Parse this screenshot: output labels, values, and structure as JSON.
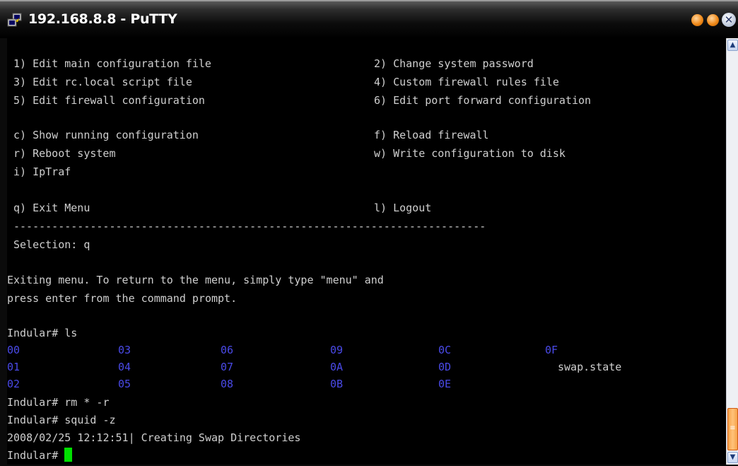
{
  "window": {
    "title": "192.168.8.8 - PuTTY"
  },
  "terminal": {
    "menu": [
      {
        "left": "1) Edit main configuration file",
        "right": "2) Change system password"
      },
      {
        "left": "3) Edit rc.local script file",
        "right": "4) Custom firewall rules file"
      },
      {
        "left": "5) Edit firewall configuration",
        "right": "6) Edit port forward configuration"
      },
      {
        "left": "c) Show running configuration",
        "right": "f) Reload firewall"
      },
      {
        "left": "r) Reboot system",
        "right": "w) Write configuration to disk"
      },
      {
        "left": "i) IpTraf",
        "right": ""
      },
      {
        "left": "q) Exit Menu",
        "right": "l) Logout"
      }
    ],
    "separator": "--------------------------------------------------------------------------",
    "selection": "Selection: q",
    "exit_line1": "Exiting menu. To return to the menu, simply type \"menu\" and",
    "exit_line2": "press enter from the command prompt.",
    "cmd_ls": "Indular# ls",
    "ls_rows": [
      [
        "00",
        "03",
        "06",
        "09",
        "0C",
        "0F"
      ],
      [
        "01",
        "04",
        "07",
        "0A",
        "0D",
        "swap.state"
      ],
      [
        "02",
        "05",
        "08",
        "0B",
        "0E",
        ""
      ]
    ],
    "cmd_rm": "Indular# rm * -r",
    "cmd_squid": "Indular# squid -z",
    "squid_output": "2008/02/25 12:12:51| Creating Swap Directories",
    "prompt": "Indular# "
  },
  "colors": {
    "directory": "#4a4ae8",
    "cursor": "#00e000",
    "text": "#cfcfcf"
  },
  "icons": {
    "app": "putty-icon",
    "minimize": "minimize-icon",
    "maximize": "maximize-icon",
    "close": "close-icon",
    "scroll_up": "arrow-up-icon",
    "scroll_down": "arrow-down-icon"
  }
}
